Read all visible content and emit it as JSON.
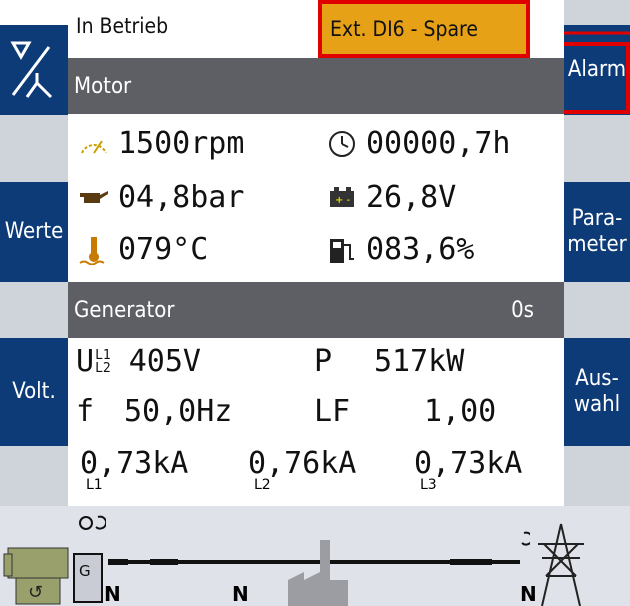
{
  "status": {
    "operating_state": "In Betrieb",
    "alarm_message": "Ext. DI6 - Spare",
    "alarm_color": "#e6a117",
    "highlight_color": "#e00000"
  },
  "softkeys_left": {
    "mode_icon": "star-delta-icon",
    "values": "Werte",
    "volt": "Volt."
  },
  "softkeys_right": {
    "alarm": "Alarm",
    "parameter": "Para-\nmeter",
    "selection": "Aus-\nwahl"
  },
  "motor": {
    "title": "Motor",
    "speed": "1500rpm",
    "hours": "00000,7h",
    "oil_pressure": "04,8bar",
    "battery_voltage": "26,8V",
    "coolant_temp": "079°C",
    "fuel_level": "083,6%"
  },
  "generator": {
    "title": "Generator",
    "timer": "0s",
    "voltage_label": "U",
    "voltage_phase_top": "L1",
    "voltage_phase_bottom": "L2",
    "voltage": "405V",
    "power_label": "P",
    "power": "517kW",
    "freq_label": "f",
    "frequency": "50,0Hz",
    "pf_label": "LF",
    "power_factor": "1,00",
    "currents": [
      {
        "value": "0,73kA",
        "phase": "L1"
      },
      {
        "value": "0,76kA",
        "phase": "L2"
      },
      {
        "value": "0,73kA",
        "phase": "L3"
      }
    ]
  },
  "diagram": {
    "neutral_labels": [
      "N",
      "N",
      "N"
    ],
    "icons": [
      "engine-icon",
      "generator-icon",
      "factory-icon",
      "mains-pylon-icon",
      "rotation-icon"
    ]
  }
}
